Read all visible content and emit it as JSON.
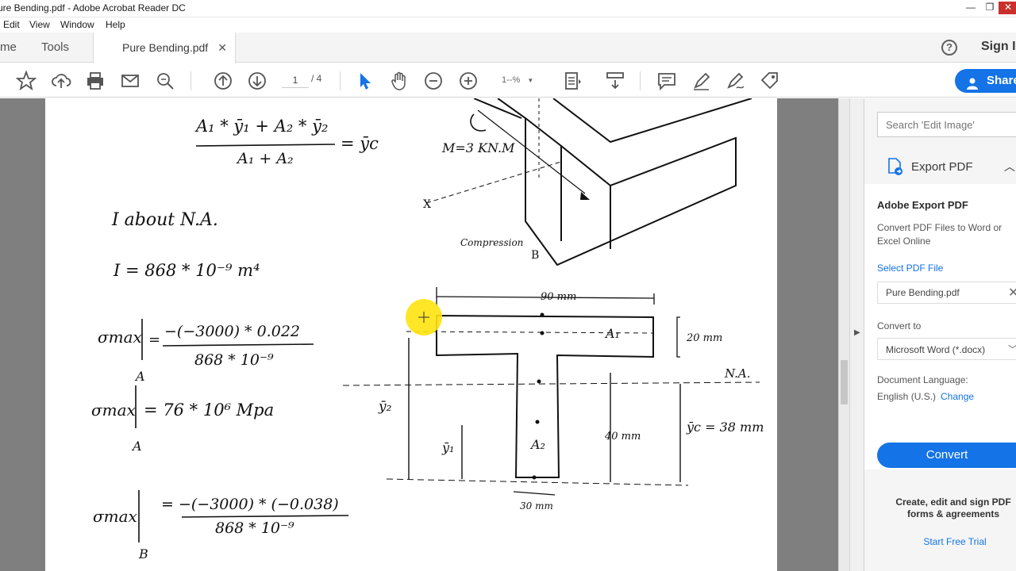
{
  "window": {
    "title": "ure Bending.pdf - Adobe Acrobat Reader DC"
  },
  "menu": {
    "items": [
      "Edit",
      "View",
      "Window",
      "Help"
    ]
  },
  "tabs": {
    "home": "me",
    "tools": "Tools",
    "document": "Pure Bending.pdf",
    "signin": "Sign I"
  },
  "toolbar": {
    "page_current": "1",
    "page_total": "/ 4",
    "zoom": "1--%",
    "share_label": "Share"
  },
  "panel": {
    "search_placeholder": "Search 'Edit Image'",
    "export_heading": "Export PDF",
    "title": "Adobe Export PDF",
    "description": "Convert PDF Files to Word or Excel Online",
    "select_file": "Select PDF File",
    "file_name": "Pure Bending.pdf",
    "convert_to_label": "Convert to",
    "convert_to_value": "Microsoft Word (*.docx)",
    "language_label": "Document Language:",
    "language_value": "English (U.S.)",
    "change_link": "Change",
    "convert_button": "Convert",
    "promo": "Create, edit and sign PDF forms & agreements",
    "trial_link": "Start Free Trial"
  },
  "notes": {
    "formula_num": "A₁ * ȳ₁ + A₂ * ȳ₂",
    "formula_den": "A₁ + A₂",
    "formula_rhs": "= ȳc",
    "i_about": "I about N.A.",
    "i_value": "I = 868 * 10⁻⁹ m⁴",
    "sigma_a_num": "−(−3000) * 0.022",
    "sigma_a_den": "868 * 10⁻⁹",
    "sigma_a_result": "= 76 * 10⁶ Mpa",
    "sigma_b_num": "= −(−3000) * (−0.038)",
    "sigma_b_den": "868 * 10⁻⁹",
    "sym_sigma": "σmax",
    "pt_a": "A",
    "pt_b": "B",
    "moment": "M=3 KN.M",
    "x_axis": "X",
    "compression": "Compression",
    "dim_90": "90 mm",
    "dim_20": "20 mm",
    "dim_40": "40 mm",
    "dim_30": "30 mm",
    "na": "N.A.",
    "yc": "ȳc = 38 mm",
    "a1": "A₁",
    "a2": "A₂",
    "y1": "ȳ₁",
    "y2": "ȳ₂"
  }
}
